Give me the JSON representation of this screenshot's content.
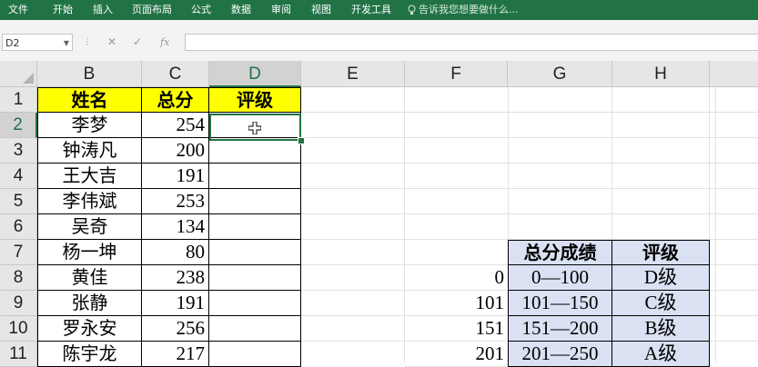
{
  "ribbon": {
    "tabs": [
      "文件",
      "开始",
      "插入",
      "页面布局",
      "公式",
      "数据",
      "审阅",
      "视图",
      "开发工具"
    ],
    "tell_me": "告诉我您想要做什么..."
  },
  "formula_bar": {
    "name_box": "D2",
    "cancel_icon": "✕",
    "enter_icon": "✓",
    "fx_label": "fx",
    "formula": ""
  },
  "columns": [
    "B",
    "C",
    "D",
    "E",
    "F",
    "G",
    "H"
  ],
  "rows": [
    "1",
    "2",
    "3",
    "4",
    "5",
    "6",
    "7",
    "8",
    "9",
    "10",
    "11"
  ],
  "table": {
    "headers": [
      "姓名",
      "总分",
      "评级"
    ],
    "records": [
      {
        "name": "李梦",
        "score": "254"
      },
      {
        "name": "钟涛凡",
        "score": "200"
      },
      {
        "name": "王大吉",
        "score": "191"
      },
      {
        "name": "李伟斌",
        "score": "253"
      },
      {
        "name": "吴奇",
        "score": "134"
      },
      {
        "name": "杨一坤",
        "score": "80"
      },
      {
        "name": "黄佳",
        "score": "238"
      },
      {
        "name": "张静",
        "score": "191"
      },
      {
        "name": "罗永安",
        "score": "256"
      },
      {
        "name": "陈宇龙",
        "score": "217"
      }
    ]
  },
  "lookup": {
    "headers": [
      "总分成绩",
      "评级"
    ],
    "rows": [
      {
        "lower": "0",
        "range": "0—100",
        "grade": "D级"
      },
      {
        "lower": "101",
        "range": "101—150",
        "grade": "C级"
      },
      {
        "lower": "151",
        "range": "151—200",
        "grade": "B级"
      },
      {
        "lower": "201",
        "range": "201—250",
        "grade": "A级"
      }
    ]
  },
  "selection": {
    "active_cell": "D2",
    "active_column": "D",
    "active_row": "2"
  },
  "colors": {
    "ribbon": "#217346",
    "header_fill": "#ffff00",
    "lookup_fill": "#d9e1f2"
  }
}
